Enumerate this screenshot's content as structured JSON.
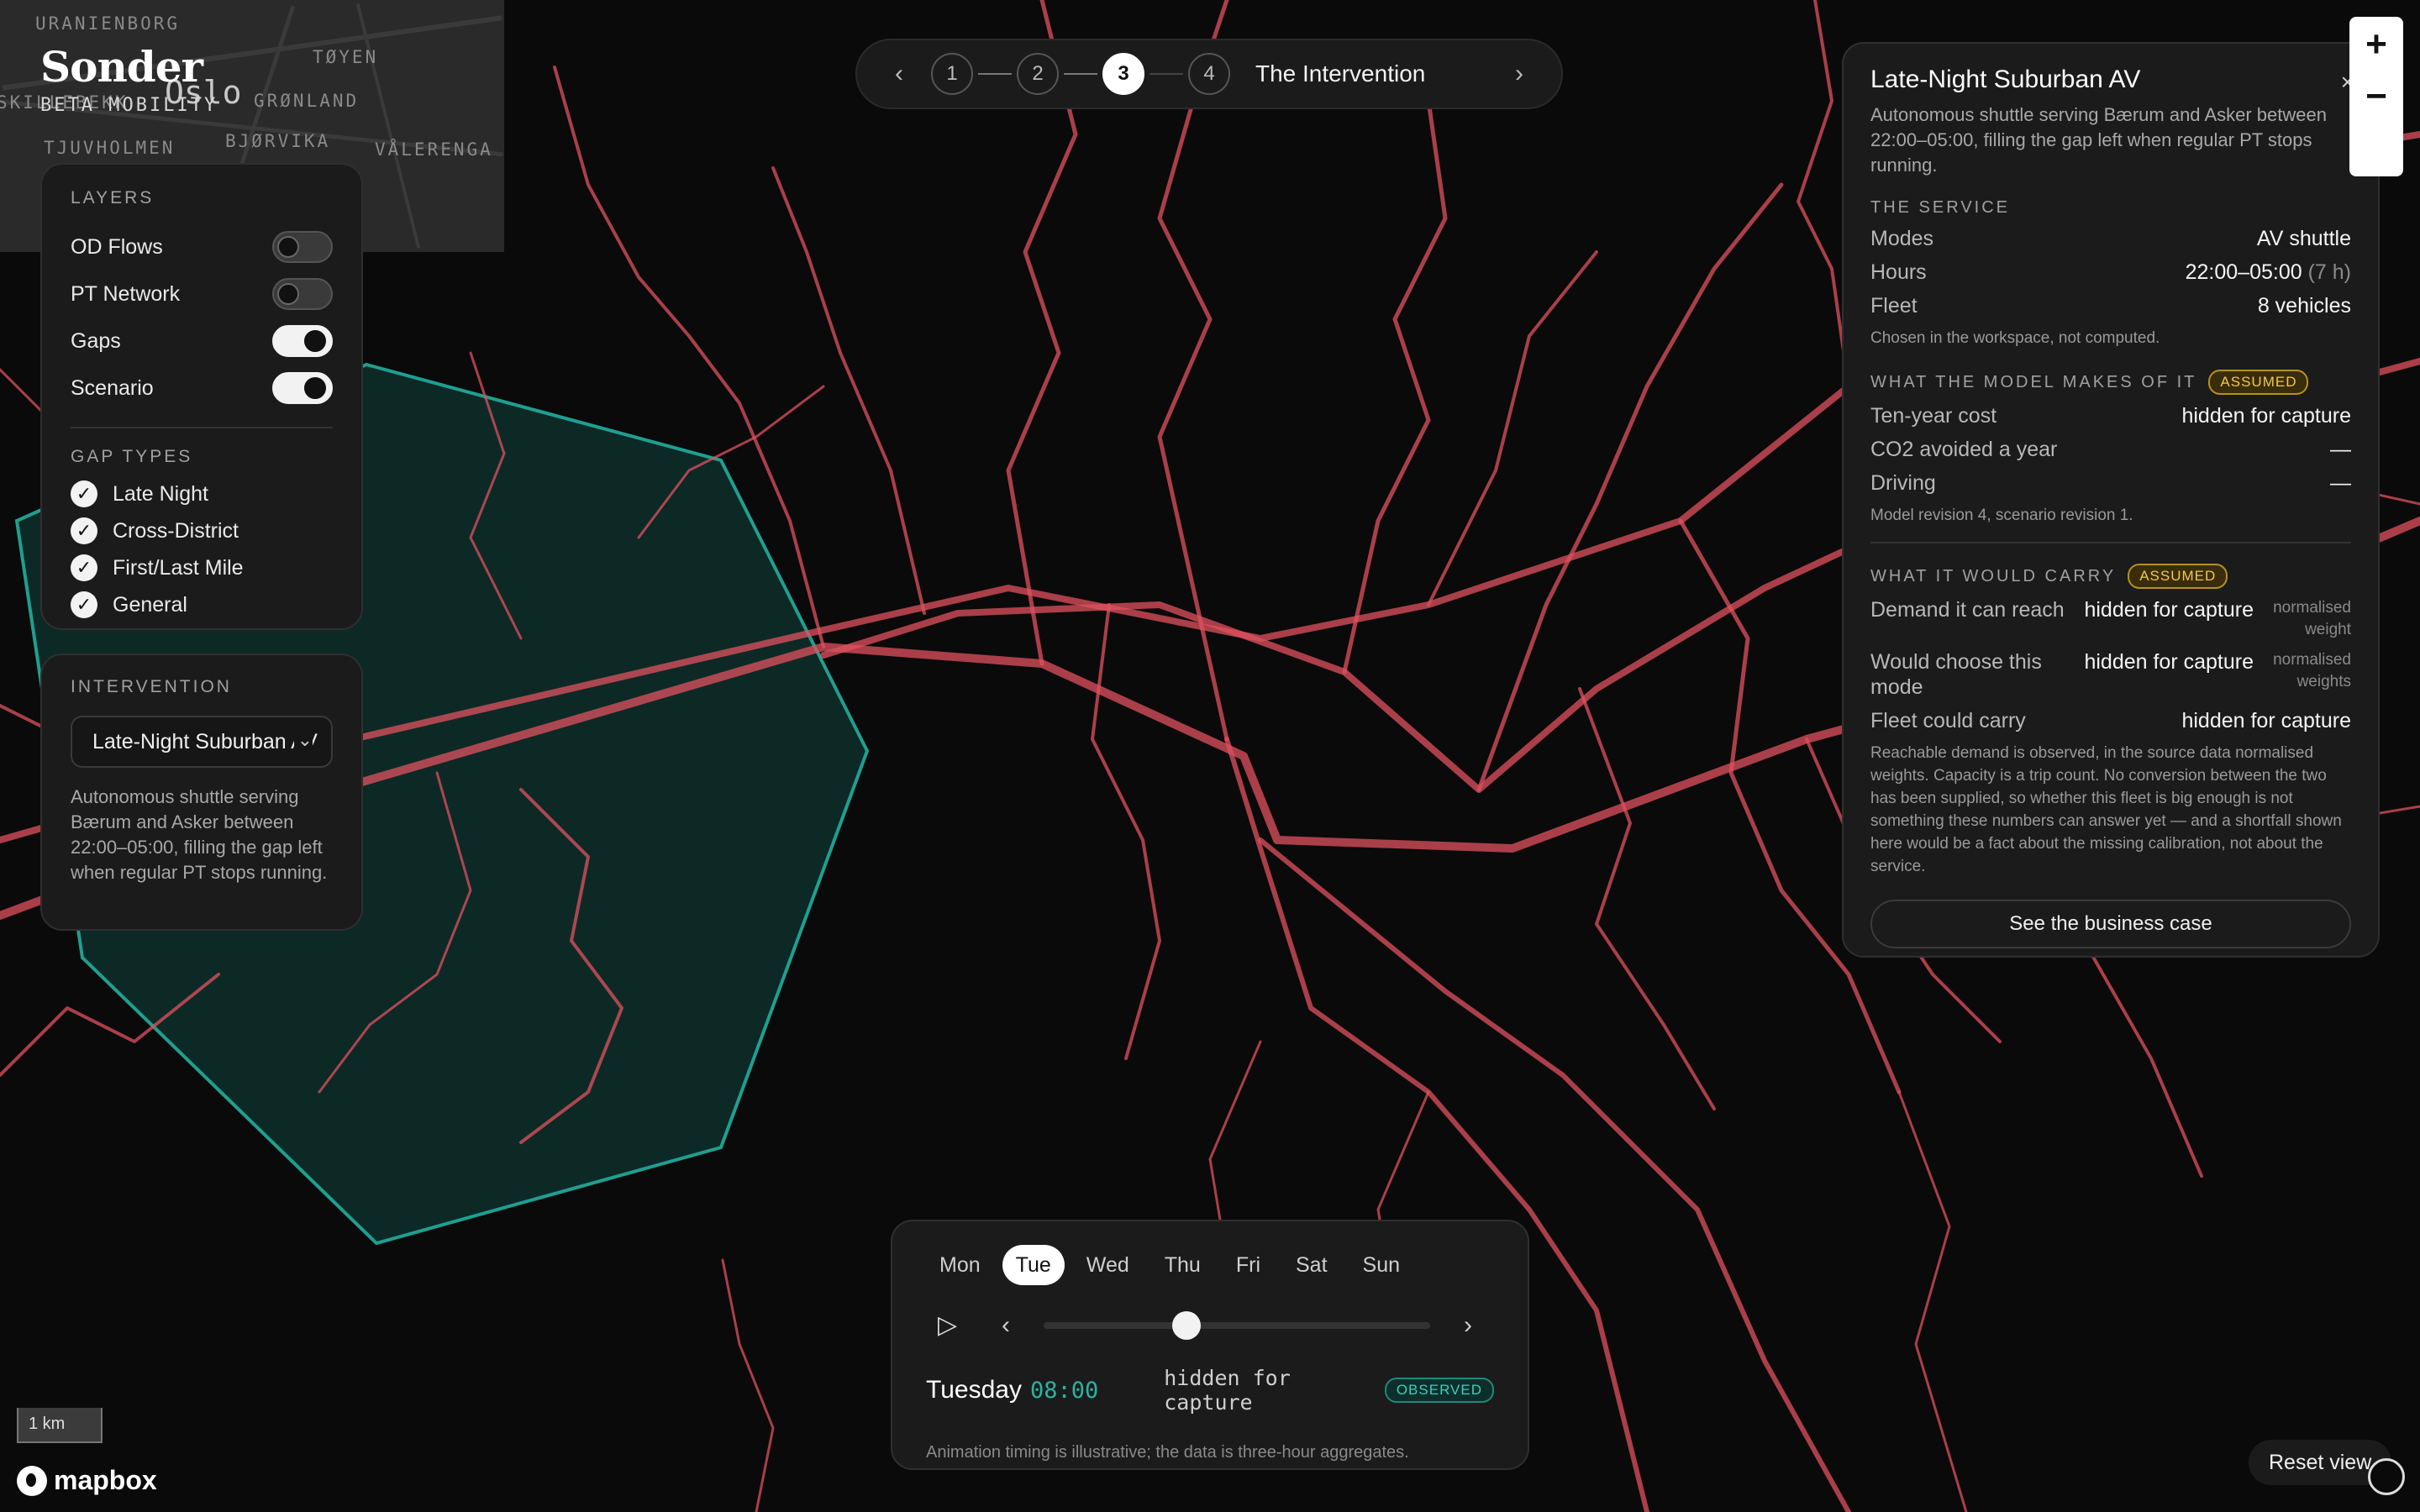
{
  "brand": {
    "name": "Sonder",
    "tag": "BETA MOBILITY"
  },
  "minimap": {
    "city": "Oslo",
    "districts": [
      "URANIENBORG",
      "TØYEN",
      "GRØNLAND",
      "TJUVHOLMEN",
      "BJØRVIKA",
      "VÅLERENGA",
      "SKILLEBEKK"
    ]
  },
  "stepper": {
    "steps": [
      "1",
      "2",
      "3",
      "4"
    ],
    "active_step": "3",
    "title": "The Intervention",
    "prev_icon": "chevron-left-icon",
    "next_icon": "chevron-right-icon"
  },
  "layers": {
    "title": "LAYERS",
    "items": [
      {
        "label": "OD Flows",
        "on": false
      },
      {
        "label": "PT Network",
        "on": false
      },
      {
        "label": "Gaps",
        "on": true
      },
      {
        "label": "Scenario",
        "on": true
      }
    ],
    "gap_types_title": "GAP TYPES",
    "gap_types": [
      "Late Night",
      "Cross-District",
      "First/Last Mile",
      "General"
    ]
  },
  "intervention": {
    "title": "INTERVENTION",
    "selected": "Late-Night Suburban AV",
    "description": "Autonomous shuttle serving Bærum and Asker between 22:00–05:00, filling the gap left when regular PT stops running."
  },
  "info": {
    "title": "Late-Night Suburban AV",
    "lede": "Autonomous shuttle serving Bærum and Asker between 22:00–05:00, filling the gap left when regular PT stops running.",
    "service": {
      "title": "THE SERVICE",
      "modes_label": "Modes",
      "modes": "AV shuttle",
      "hours_label": "Hours",
      "hours": "22:00–05:00",
      "hours_extra": "(7 h)",
      "fleet_label": "Fleet",
      "fleet": "8 vehicles",
      "note": "Chosen in the workspace, not computed."
    },
    "model": {
      "title": "WHAT THE MODEL MAKES OF IT",
      "badge": "ASSUMED",
      "cost_label": "Ten-year cost",
      "cost": "hidden for capture",
      "co2_label": "CO2 avoided a year",
      "co2": "—",
      "driving_label": "Driving",
      "driving": "—",
      "note": "Model revision 4, scenario revision 1."
    },
    "carry": {
      "title": "WHAT IT WOULD CARRY",
      "badge": "ASSUMED",
      "demand_label": "Demand it can reach",
      "demand": "hidden for capture",
      "demand_unit": "normalised weight",
      "choose_label": "Would choose this mode",
      "choose": "hidden for capture",
      "choose_unit": "normalised weights",
      "fleet_label": "Fleet could carry",
      "fleet": "hidden for capture",
      "note": "Reachable demand is observed, in the source data normalised weights. Capacity is a trip count. No conversion between the two has been supplied, so whether this fleet is big enough is not something these numbers can answer yet — and a shortfall shown here would be a fact about the missing calibration, not about the service."
    },
    "cta": "See the business case"
  },
  "zoom": {
    "in": "+",
    "out": "−"
  },
  "timeline": {
    "days": [
      "Mon",
      "Tue",
      "Wed",
      "Thu",
      "Fri",
      "Sat",
      "Sun"
    ],
    "active_day": "Tue",
    "position": 0.36,
    "day_name": "Tuesday",
    "time": "08:00",
    "value": "hidden for capture",
    "badge": "OBSERVED",
    "note": "Animation timing is illustrative; the data is three-hour aggregates."
  },
  "map": {
    "scale": "1 km",
    "attribution": "mapbox",
    "reset": "Reset view",
    "zone_color": "#1f8f82",
    "route_color": "#e0515f"
  }
}
